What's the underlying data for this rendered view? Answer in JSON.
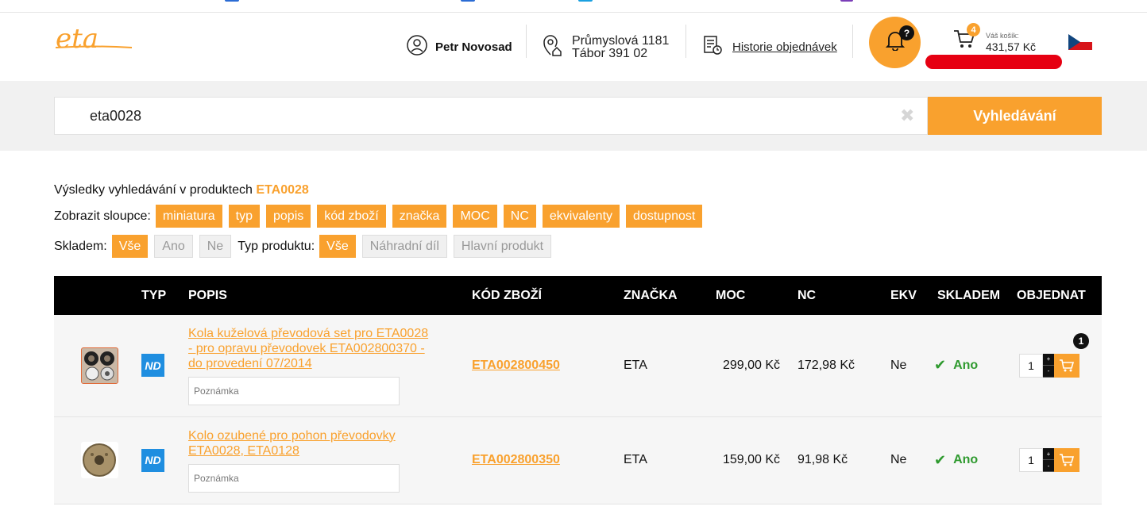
{
  "colors": {
    "accent": "#f9a12e",
    "header_black": "#000000",
    "type_badge": "#1f8ee0",
    "available_green": "#2f9a2f",
    "redacted": "#e60012"
  },
  "header": {
    "user_name": "Petr Novosad",
    "address_line1": "Průmyslová 1181",
    "address_line2": "Tábor 391 02",
    "history_label": "Historie objednávek",
    "notifications_badge": "?",
    "cart_count": "4",
    "cart_label": "Váš košík:",
    "cart_total": "431,57 Kč",
    "language": "cs"
  },
  "search": {
    "value": "eta0028",
    "clear_icon": "✖",
    "button_label": "Vyhledávání"
  },
  "results": {
    "prefix": "Výsledky vyhledávání v produktech",
    "query": "ETA0028"
  },
  "columns_filter": {
    "label": "Zobrazit sloupce:",
    "chips": [
      "miniatura",
      "typ",
      "popis",
      "kód zboží",
      "značka",
      "MOC",
      "NC",
      "ekvivalenty",
      "dostupnost"
    ]
  },
  "stock_filter": {
    "label": "Skladem:",
    "options": [
      "Vše",
      "Ano",
      "Ne"
    ],
    "selected": "Vše"
  },
  "type_filter": {
    "label": "Typ produktu:",
    "options": [
      "Vše",
      "Náhradní díl",
      "Hlavní produkt"
    ],
    "selected": "Vše"
  },
  "table": {
    "headers": {
      "typ": "TYP",
      "popis": "POPIS",
      "kod": "KÓD ZBOŽÍ",
      "znacka": "ZNAČKA",
      "moc": "MOC",
      "nc": "NC",
      "ekv": "EKV",
      "skladem": "SKLADEM",
      "objednat": "OBJEDNAT"
    },
    "rows": [
      {
        "type": "ND",
        "description": "Kola kuželová převodová set pro ETA0028 - pro opravu převodovek ETA002800370 - do provedení 07/2014",
        "note_placeholder": "Poznámka",
        "code": "ETA002800450",
        "brand": "ETA",
        "moc": "299,00 Kč",
        "nc": "172,98 Kč",
        "ekv": "Ne",
        "stock": "Ano",
        "qty": "1",
        "in_cart": "1"
      },
      {
        "type": "ND",
        "description": "Kolo ozubené pro pohon převodovky ETA0028, ETA0128",
        "note_placeholder": "Poznámka",
        "code": "ETA002800350",
        "brand": "ETA",
        "moc": "159,00 Kč",
        "nc": "91,98 Kč",
        "ekv": "Ne",
        "stock": "Ano",
        "qty": "1",
        "in_cart": ""
      }
    ]
  }
}
